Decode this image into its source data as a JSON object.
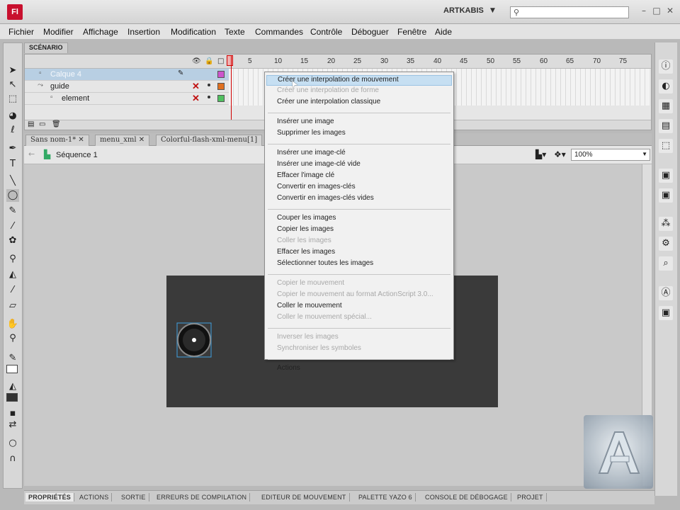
{
  "app": {
    "logo": "Fl",
    "workspace": "ARTKABIS",
    "search_placeholder": ""
  },
  "menubar": [
    "Fichier",
    "Modifier",
    "Affichage",
    "Insertion",
    "Modification",
    "Texte",
    "Commandes",
    "Contrôle",
    "Déboguer",
    "Fenêtre",
    "Aide"
  ],
  "timeline": {
    "panel_title": "SCÉNARIO",
    "frame_numbers": [
      "1",
      "5",
      "10",
      "15",
      "20",
      "25",
      "30",
      "35",
      "40",
      "45",
      "50",
      "55",
      "60",
      "65",
      "70",
      "75"
    ],
    "layers": [
      {
        "name": "Calque 4",
        "color": "#cc55cc"
      },
      {
        "name": "guide",
        "color": "#e07020"
      },
      {
        "name": "element",
        "color": "#50c060"
      }
    ]
  },
  "doc_tabs": [
    "Sans nom-1*",
    "menu_xml",
    "Colorful-flash-xml-menu[1]"
  ],
  "edit_bar": {
    "scene": "Séquence 1",
    "zoom": "100%"
  },
  "context_menu": {
    "groups": [
      [
        {
          "label": "Créer une interpolation de mouvement",
          "enabled": true
        },
        {
          "label": "Créer une interpolation de forme",
          "enabled": false
        },
        {
          "label": "Créer une interpolation classique",
          "enabled": true
        }
      ],
      [
        {
          "label": "Insérer une image",
          "enabled": true
        },
        {
          "label": "Supprimer les images",
          "enabled": true
        }
      ],
      [
        {
          "label": "Insérer une image-clé",
          "enabled": true
        },
        {
          "label": "Insérer une image-clé vide",
          "enabled": true
        },
        {
          "label": "Effacer l'image clé",
          "enabled": true
        },
        {
          "label": "Convertir en images-clés",
          "enabled": true
        },
        {
          "label": "Convertir en images-clés vides",
          "enabled": true
        }
      ],
      [
        {
          "label": "Couper les images",
          "enabled": true
        },
        {
          "label": "Copier les images",
          "enabled": true
        },
        {
          "label": "Coller les images",
          "enabled": false
        },
        {
          "label": "Effacer les images",
          "enabled": true
        },
        {
          "label": "Sélectionner toutes les images",
          "enabled": true
        }
      ],
      [
        {
          "label": "Copier le mouvement",
          "enabled": false
        },
        {
          "label": "Copier le mouvement au format ActionScript 3.0...",
          "enabled": false
        },
        {
          "label": "Coller le mouvement",
          "enabled": true
        },
        {
          "label": "Coller le mouvement spécial...",
          "enabled": false
        }
      ],
      [
        {
          "label": "Inverser les images",
          "enabled": false
        },
        {
          "label": "Synchroniser les symboles",
          "enabled": false
        }
      ],
      [
        {
          "label": "Actions",
          "enabled": true
        }
      ]
    ]
  },
  "bottom_tabs": [
    "PROPRIÉTÉS",
    "ACTIONS",
    "SORTIE",
    "ERREURS DE COMPILATION",
    "EDITEUR DE MOUVEMENT",
    "PALETTE YAZO 6",
    "CONSOLE DE DÉBOGAGE",
    "PROJET"
  ],
  "colors": {
    "stage": "#3a3a3a",
    "menu_highlight": "#c6dff2",
    "accent_red": "#c8102e"
  },
  "icons": {
    "left_tools": [
      "selection-arrow-icon",
      "subselection-icon",
      "free-transform-icon",
      "3d-rotation-icon",
      "lasso-icon",
      "pen-icon",
      "text-icon",
      "line-icon",
      "oval-icon",
      "pencil-icon",
      "brush-icon",
      "deco-icon",
      "bone-icon",
      "paint-bucket-icon",
      "eyedropper-icon",
      "eraser-icon",
      "hand-icon",
      "zoom-icon"
    ],
    "right_dock": [
      "info-icon",
      "color-icon",
      "swatches-icon",
      "align-icon",
      "transform-icon",
      "library-icon",
      "components-icon",
      "behaviors-icon",
      "motion-presets-icon",
      "movie-explorer-icon",
      "strings-icon"
    ]
  }
}
